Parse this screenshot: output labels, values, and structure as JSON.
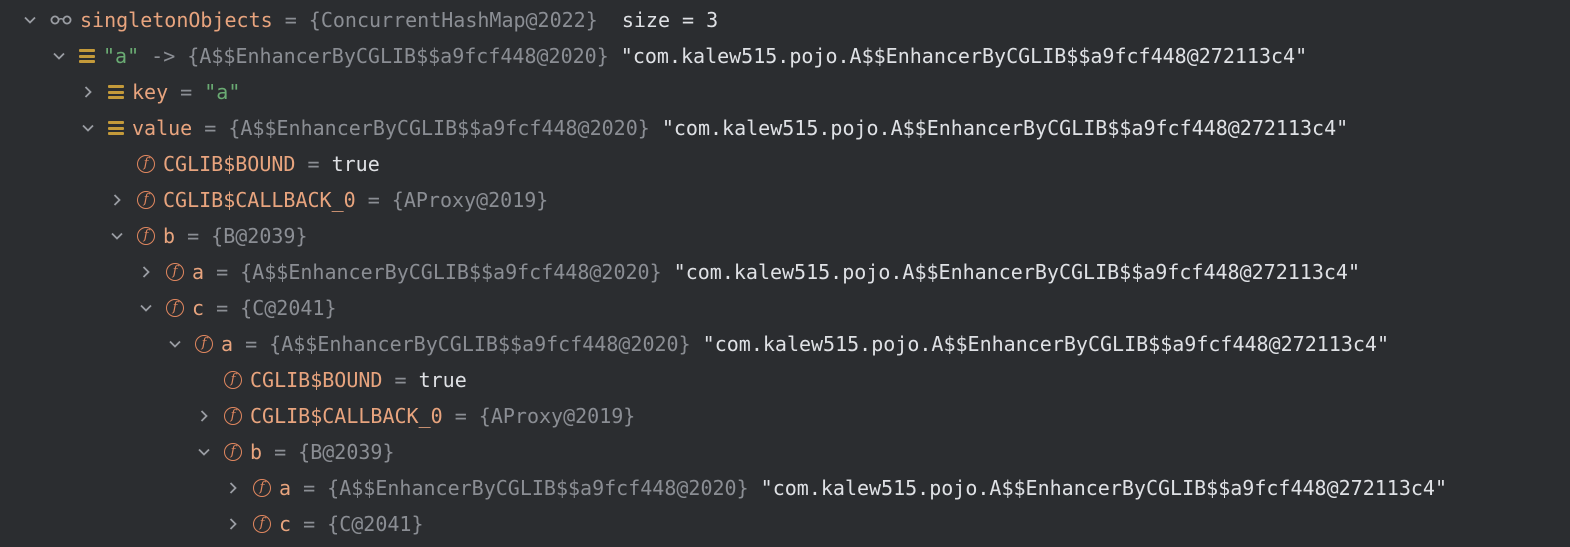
{
  "rows": [
    {
      "name": "singletonObjects",
      "eq": " = ",
      "type": "{ConcurrentHashMap@2022}",
      "value": "  size = 3"
    },
    {
      "name": "\"a\"",
      "eq": " -> ",
      "type": "{A$$EnhancerByCGLIB$$a9fcf448@2020}",
      "value": " \"com.kalew515.pojo.A$$EnhancerByCGLIB$$a9fcf448@272113c4\""
    },
    {
      "name": "key",
      "eq": " = ",
      "type": "",
      "value": "\"a\""
    },
    {
      "name": "value",
      "eq": " = ",
      "type": "{A$$EnhancerByCGLIB$$a9fcf448@2020}",
      "value": " \"com.kalew515.pojo.A$$EnhancerByCGLIB$$a9fcf448@272113c4\""
    },
    {
      "name": "CGLIB$BOUND",
      "eq": " = ",
      "type": "",
      "value": "true"
    },
    {
      "name": "CGLIB$CALLBACK_0",
      "eq": " = ",
      "type": "{AProxy@2019}",
      "value": ""
    },
    {
      "name": "b",
      "eq": " = ",
      "type": "{B@2039}",
      "value": ""
    },
    {
      "name": "a",
      "eq": " = ",
      "type": "{A$$EnhancerByCGLIB$$a9fcf448@2020}",
      "value": " \"com.kalew515.pojo.A$$EnhancerByCGLIB$$a9fcf448@272113c4\""
    },
    {
      "name": "c",
      "eq": " = ",
      "type": "{C@2041}",
      "value": ""
    },
    {
      "name": "a",
      "eq": " = ",
      "type": "{A$$EnhancerByCGLIB$$a9fcf448@2020}",
      "value": " \"com.kalew515.pojo.A$$EnhancerByCGLIB$$a9fcf448@272113c4\""
    },
    {
      "name": "CGLIB$BOUND",
      "eq": " = ",
      "type": "",
      "value": "true"
    },
    {
      "name": "CGLIB$CALLBACK_0",
      "eq": " = ",
      "type": "{AProxy@2019}",
      "value": ""
    },
    {
      "name": "b",
      "eq": " = ",
      "type": "{B@2039}",
      "value": ""
    },
    {
      "name": "a",
      "eq": " = ",
      "type": "{A$$EnhancerByCGLIB$$a9fcf448@2020}",
      "value": " \"com.kalew515.pojo.A$$EnhancerByCGLIB$$a9fcf448@272113c4\""
    },
    {
      "name": "c",
      "eq": " = ",
      "type": "{C@2041}",
      "value": ""
    }
  ],
  "colors": {
    "background": "#2b2d30",
    "field_name": "#e8a47e",
    "string": "#6aab73",
    "grey": "#8b8e94",
    "field_icon": "#e0875f",
    "map_entry_icon": "#c49a3a"
  },
  "icons": {
    "watch": "watch-glasses-icon",
    "entry": "map-entry-icon",
    "field": "field-icon",
    "expanded": "chevron-down-icon",
    "collapsed": "chevron-right-icon"
  }
}
